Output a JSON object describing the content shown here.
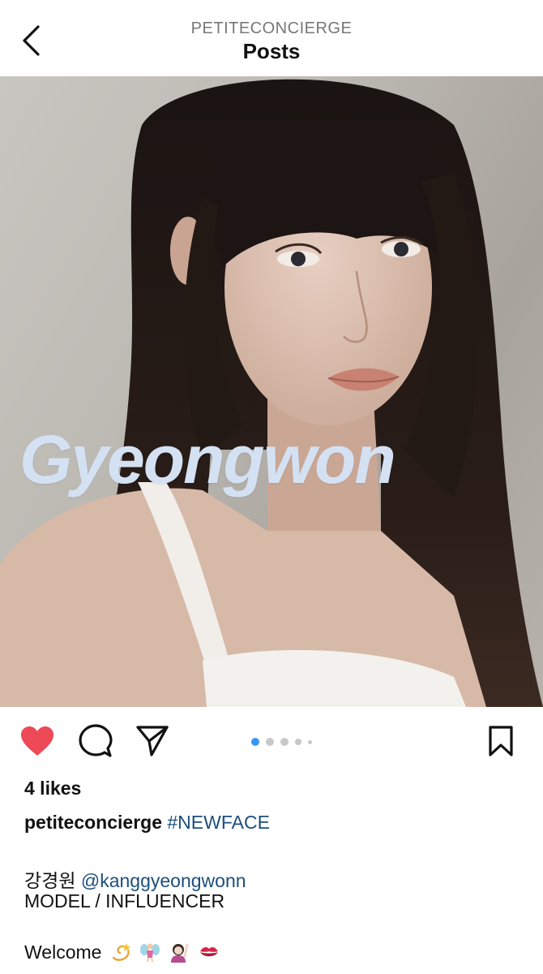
{
  "header": {
    "account": "PETITECONCIERGE",
    "title": "Posts"
  },
  "photo": {
    "overlay_text": "Gyeongwon",
    "overlay_color": "#d4e1f3"
  },
  "actions": {
    "liked": true,
    "like_color": "#ed4956",
    "carousel": {
      "total": 5,
      "active": 1,
      "active_color": "#3897f0"
    }
  },
  "post": {
    "likes": "4 likes",
    "author": "petiteconcierge",
    "hashtag": "#NEWFACE",
    "name_korean": "강경원",
    "mention": "@kanggyeongwonn",
    "role": "MODEL / INFLUENCER",
    "welcome": "Welcome",
    "welcome_emojis": [
      "dizzy",
      "fairy",
      "raising-hand-woman",
      "kiss-mark"
    ]
  },
  "colors": {
    "link": "#1d4e7c",
    "muted": "#777777"
  }
}
